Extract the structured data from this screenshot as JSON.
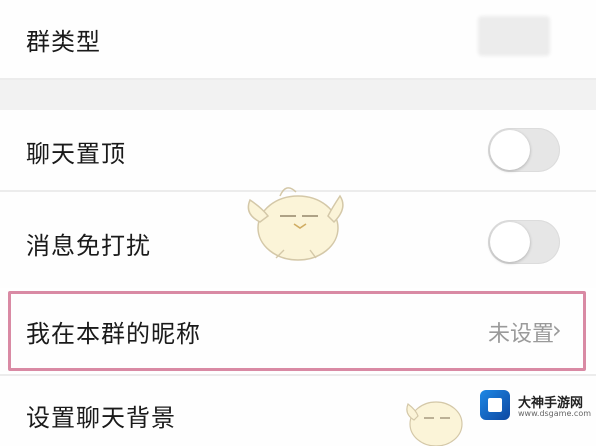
{
  "settings": {
    "group_type_label": "群类型",
    "pin_chat_label": "聊天置顶",
    "mute_label": "消息免打扰",
    "nickname_label": "我在本群的昵称",
    "nickname_value": "未设置",
    "background_label": "设置聊天背景",
    "pin_chat_on": false,
    "mute_on": false
  },
  "icons": {
    "chevron": "›",
    "toggle_pin": "toggle-switch",
    "toggle_mute": "toggle-switch",
    "watermark": "mascot-bird"
  },
  "watermark": {
    "title": "大神手游网",
    "url": "www.dsgame.com"
  },
  "colors": {
    "highlight_border": "#d98aa4",
    "toggle_off": "#e6e6e6",
    "value_gray": "#9a9a9a"
  }
}
